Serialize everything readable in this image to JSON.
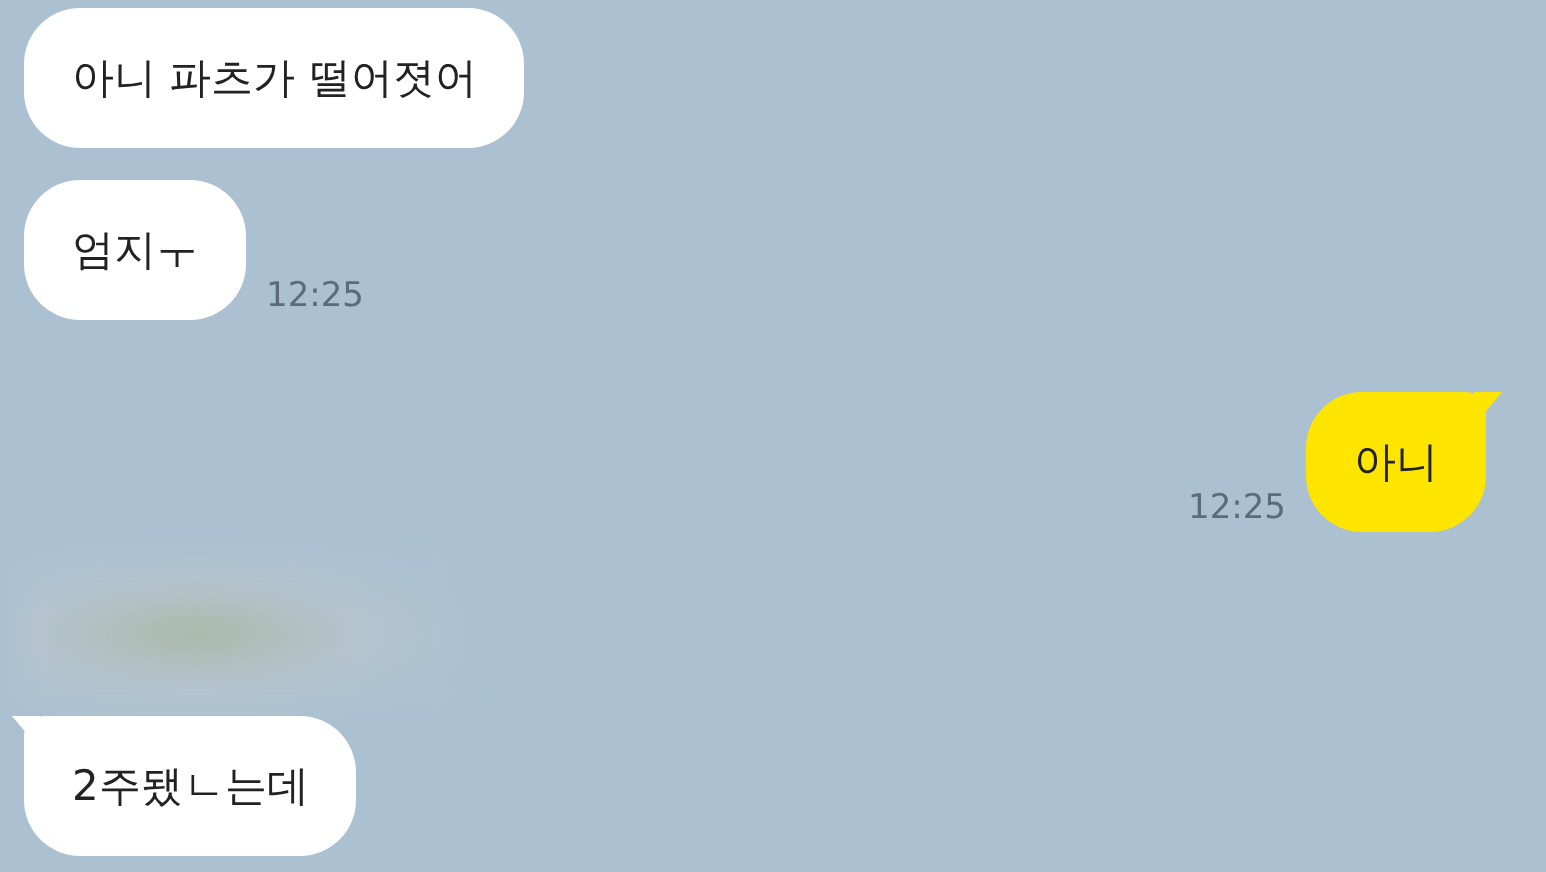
{
  "messages": [
    {
      "kind": "message",
      "sent": false,
      "text": "아니 파츠가 떨어졋어",
      "tail": false
    },
    {
      "kind": "message",
      "sent": false,
      "text": "엄지ㅜ",
      "time": "12:25",
      "tail": false
    },
    {
      "kind": "message",
      "sent": true,
      "text": "아니",
      "time": "12:25",
      "tail": true
    },
    {
      "kind": "blurred"
    },
    {
      "kind": "message",
      "sent": false,
      "text": "2주됐ㄴ는데",
      "tail": true
    }
  ]
}
